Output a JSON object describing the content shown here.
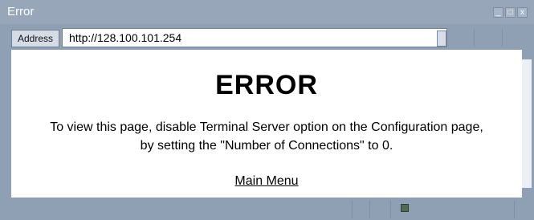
{
  "window": {
    "title": "Error",
    "controls": [
      "_",
      "□",
      "x"
    ]
  },
  "address_bar": {
    "label": "Address",
    "url": "http://128.100.101.254"
  },
  "page": {
    "heading": "ERROR",
    "message_line1": "To view this page, disable Terminal Server option on the Configuration page,",
    "message_line2": "by setting the \"Number of Connections\" to 0.",
    "link": "Main Menu"
  }
}
